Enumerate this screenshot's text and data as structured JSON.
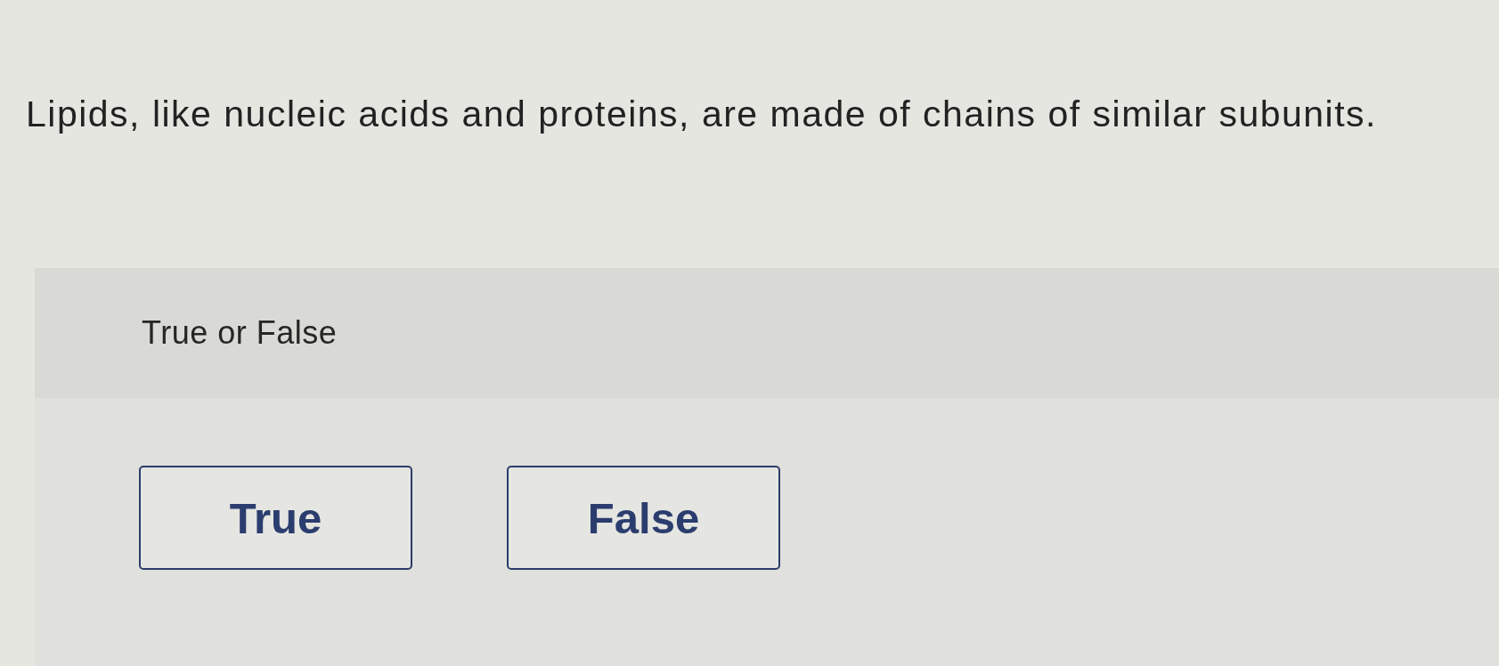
{
  "question": {
    "text": "Lipids, like nucleic acids and proteins, are made of chains of similar subunits."
  },
  "answer_panel": {
    "prompt": "True or False",
    "options": [
      {
        "label": "True",
        "selected": false
      },
      {
        "label": "False",
        "selected": false
      }
    ]
  }
}
